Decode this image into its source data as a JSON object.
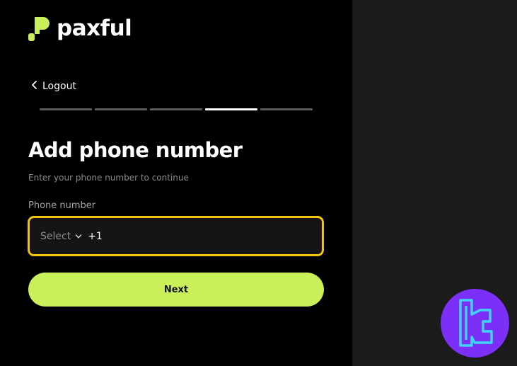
{
  "brand": {
    "name": "paxful",
    "accent": "#c9ef5a",
    "logo_icon": "paxful-logo-mark"
  },
  "nav": {
    "back_label": "Logout",
    "back_icon": "chevron-left-icon"
  },
  "progress": {
    "total_steps": 5,
    "current_step": 4
  },
  "page": {
    "title": "Add phone number",
    "subtitle": "Enter your phone number to continue"
  },
  "form": {
    "phone_label": "Phone number",
    "country_select": "Select",
    "dial_code": "+1",
    "phone_value": "",
    "focus_color": "#f1c40f"
  },
  "actions": {
    "next_label": "Next"
  },
  "watermark": {
    "icon": "tc-badge-logo",
    "background": "#7b2ff7",
    "stroke": "#3fd3f5"
  }
}
